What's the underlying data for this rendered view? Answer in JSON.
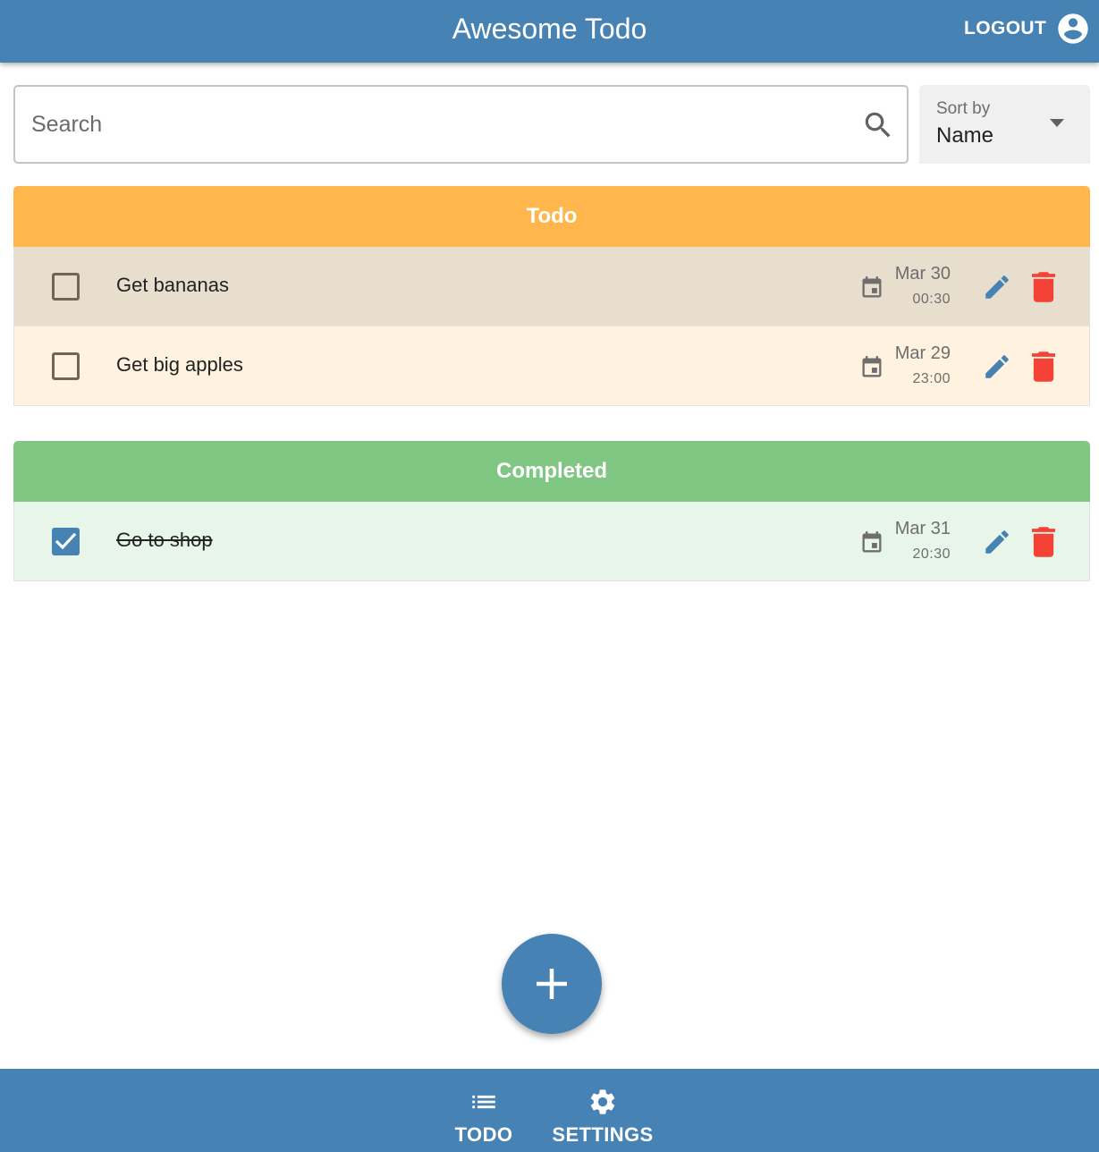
{
  "appbar": {
    "title": "Awesome Todo",
    "logout_label": "LOGOUT",
    "account_icon": "account-circle-icon"
  },
  "search": {
    "placeholder": "Search",
    "value": "",
    "icon": "search-icon"
  },
  "sort": {
    "label": "Sort by",
    "value": "Name",
    "icon": "dropdown-caret-icon"
  },
  "sections": {
    "todo": {
      "title": "Todo",
      "color": "#ffb74d",
      "tasks": [
        {
          "name": "Get bananas",
          "date": "Mar 30",
          "time": "00:30",
          "completed": false
        },
        {
          "name": "Get big apples",
          "date": "Mar 29",
          "time": "23:00",
          "completed": false
        }
      ]
    },
    "completed": {
      "title": "Completed",
      "color": "#81c784",
      "tasks": [
        {
          "name": "Go to shop",
          "date": "Mar 31",
          "time": "20:30",
          "completed": true
        }
      ]
    }
  },
  "fab": {
    "icon": "add-icon"
  },
  "bottom_nav": {
    "items": [
      {
        "label": "TODO",
        "icon": "list-icon"
      },
      {
        "label": "SETTINGS",
        "icon": "gear-icon"
      }
    ]
  },
  "colors": {
    "primary": "#4682b4",
    "todo_header": "#ffb74d",
    "completed_header": "#81c784",
    "delete": "#f44336"
  }
}
